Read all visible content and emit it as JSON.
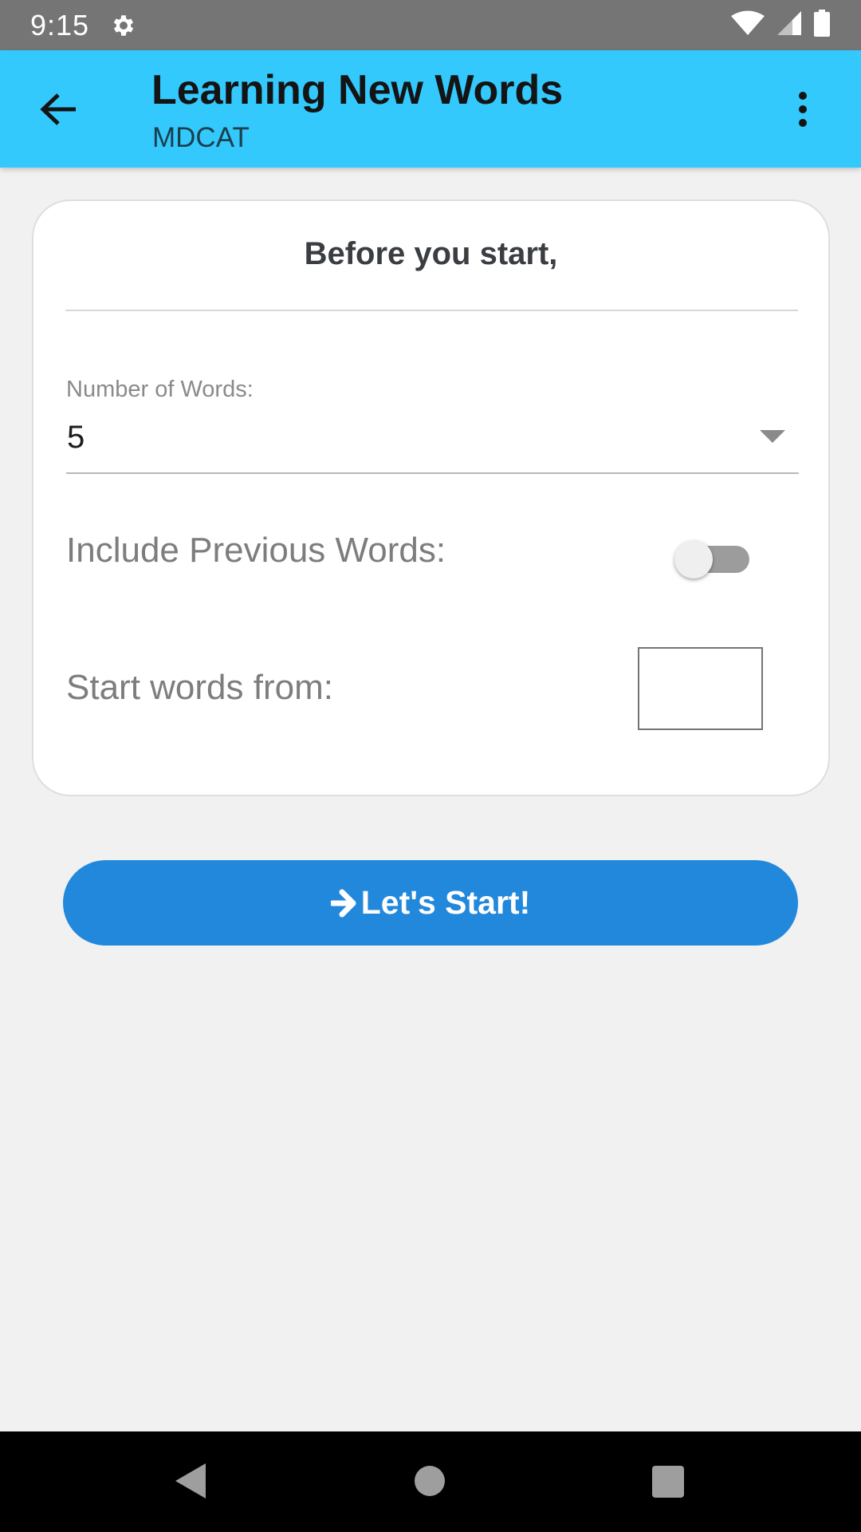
{
  "status_bar": {
    "time": "9:15",
    "icons": [
      "settings-gear-icon",
      "wifi-icon",
      "cell-signal-icon",
      "battery-icon"
    ]
  },
  "app_bar": {
    "title": "Learning New Words",
    "subtitle": "MDCAT",
    "back_icon": "arrow-back-icon",
    "menu_icon": "more-vert-icon",
    "background_color": "#33c9fd"
  },
  "card": {
    "heading": "Before you start,",
    "number_of_words": {
      "label": "Number of Words:",
      "selected": "5"
    },
    "include_previous": {
      "label": "Include Previous Words:",
      "enabled": false
    },
    "start_from": {
      "label": "Start words from:",
      "value": ""
    }
  },
  "start_button": {
    "label": "Let's Start!",
    "icon": "arrow-right-icon",
    "color": "#2288dc"
  },
  "nav_bar": {
    "icons": [
      "nav-back-icon",
      "nav-home-icon",
      "nav-recents-icon"
    ]
  }
}
